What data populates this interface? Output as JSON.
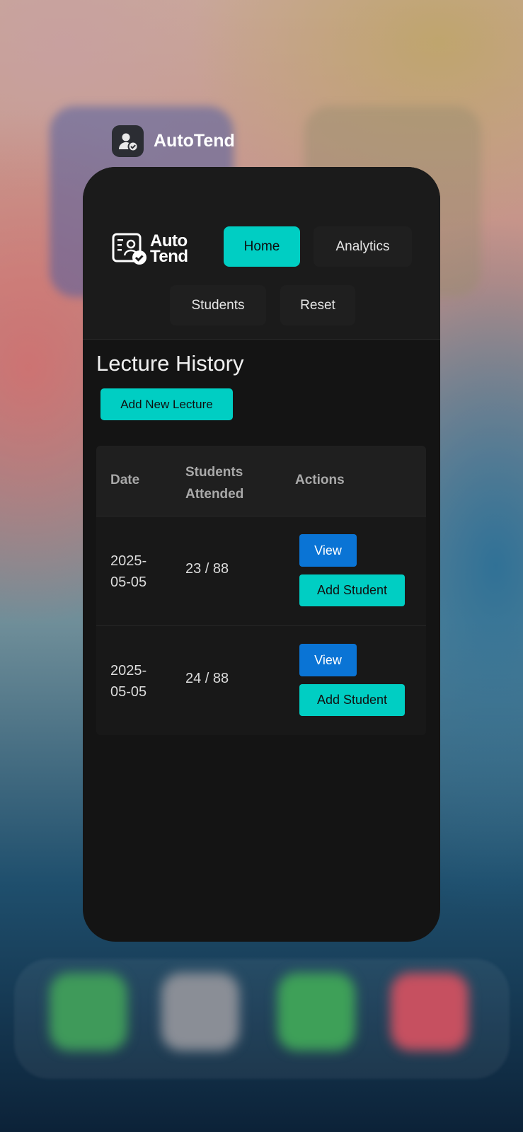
{
  "switcher": {
    "app_name": "AutoTend",
    "icon": "user-check-icon"
  },
  "navbar": {
    "logo": {
      "line1": "Auto",
      "line2": "Tend",
      "icon": "id-card-check-icon"
    },
    "items": [
      {
        "label": "Home",
        "active": true
      },
      {
        "label": "Analytics",
        "active": false
      },
      {
        "label": "Students",
        "active": false
      },
      {
        "label": "Reset",
        "active": false
      }
    ]
  },
  "main": {
    "title": "Lecture History",
    "add_button": "Add New Lecture",
    "table": {
      "headers": {
        "date": "Date",
        "students": "Students Attended",
        "actions": "Actions"
      },
      "rows": [
        {
          "date": "2025-\n05-05",
          "attended": "23 / 88",
          "view": "View",
          "add": "Add Student"
        },
        {
          "date": "2025-\n05-05",
          "attended": "24 / 88",
          "view": "View",
          "add": "Add Student"
        }
      ]
    }
  },
  "colors": {
    "accent": "#00cec3",
    "view_button": "#0a74d5",
    "card_bg": "#141414",
    "navbar_bg": "#1b1b1b"
  }
}
